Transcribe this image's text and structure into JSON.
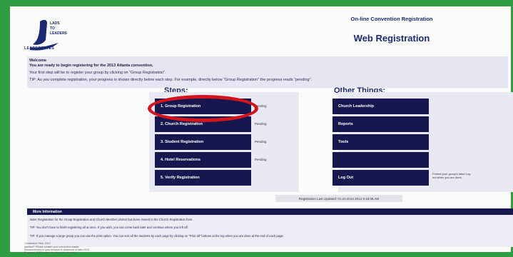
{
  "header": {
    "logo_text": "LEADERETTES",
    "subtitle": "On-line Convention Registration",
    "title": "Web Registration"
  },
  "welcome": {
    "line1": "Welcome",
    "line2": "You are ready to begin registering for the 2013 Atlanta convention.",
    "line3": "Your first step will be to register your group by clicking on \"Group Registration\".",
    "line4": "TIP: As you complete registration, your progress is shown directly below each step. For example, directly below \"Group Registration\" the progress reads \"pending\"."
  },
  "steps": {
    "heading": "Steps:",
    "items": [
      {
        "label": "1. Group Registration",
        "status": "Pending"
      },
      {
        "label": "2. Church Registration",
        "status": "Pending"
      },
      {
        "label": "3. Student Registration",
        "status": "Pending"
      },
      {
        "label": "4. Hotel Reservations",
        "status": "Pending"
      },
      {
        "label": "5. Verify Registration",
        "status": ""
      }
    ]
  },
  "other": {
    "heading": "Other Things:",
    "items": [
      {
        "label": "Church Leadership"
      },
      {
        "label": "Reports"
      },
      {
        "label": "Tools"
      },
      {
        "label": ""
      },
      {
        "label": "Log Out"
      }
    ],
    "logout_note": "Protect your group's data! Log out when you are done."
  },
  "last_updated": "Registration Last Updated: 01.22.2013 2013 9:18:08 AM",
  "more_info": {
    "heading": "More Information",
    "rows": [
      "Note: Registration for the Group Registration and Church Member photos has been moved to the Church Registration form.",
      "TIP: You don't have to finish registering all at once. If you wish, you can come back later and continue where you left off.",
      "TIP: If you manage a large group you can use the print option. You can sort all the students by each page by clicking on \"Print all\" buttons at the top when you are done at the end of each page."
    ]
  },
  "footer": {
    "lines": [
      "Convention Help: 2013",
      "Advised? Please contact your convention leader",
      "Recommended to your browser & download or later 2010",
      "Copyright 2013 Lads to Leaders / Leaderettes"
    ]
  }
}
